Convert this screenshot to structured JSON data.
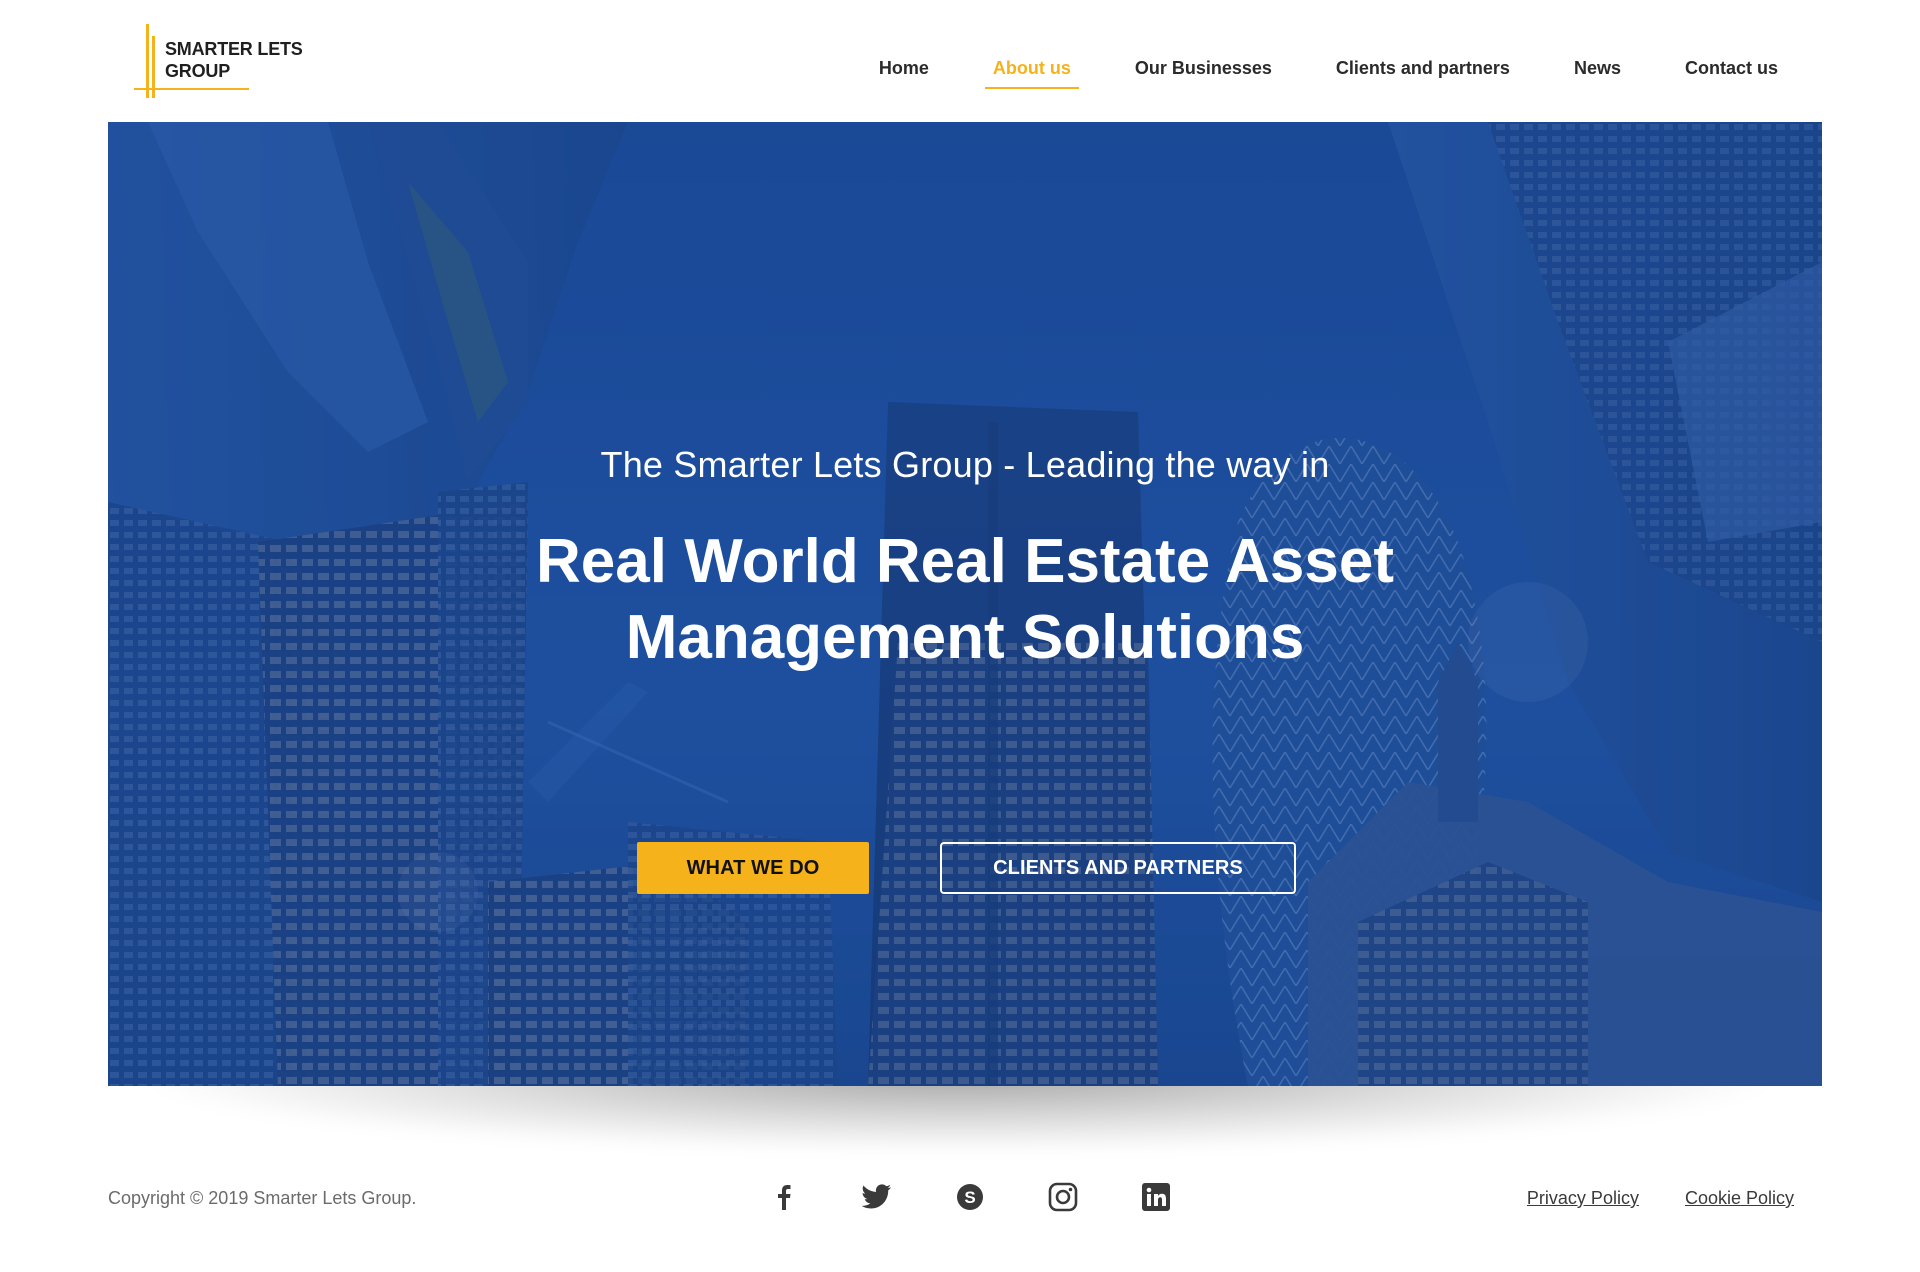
{
  "brand": {
    "name_line1": "SMARTER LETS",
    "name_line2": "GROUP",
    "accent_color": "#f5b21b"
  },
  "nav": {
    "items": [
      {
        "label": "Home",
        "active": false
      },
      {
        "label": "About us",
        "active": true
      },
      {
        "label": "Our Businesses",
        "active": false
      },
      {
        "label": "Clients and partners",
        "active": false
      },
      {
        "label": "News",
        "active": false
      },
      {
        "label": "Contact us",
        "active": false
      }
    ]
  },
  "hero": {
    "subtitle": "The Smarter Lets Group - Leading the way in",
    "title_line1": "Real World Real Estate Asset",
    "title_line2": "Management Solutions",
    "primary_button": "WHAT WE DO",
    "secondary_button": "CLIENTS AND PARTNERS",
    "overlay_color": "#1d50a0"
  },
  "footer": {
    "copyright": "Copyright © 2019 Smarter Lets Group.",
    "socials": [
      "facebook-icon",
      "twitter-icon",
      "skype-icon",
      "instagram-icon",
      "linkedin-icon"
    ],
    "links": [
      "Privacy Policy",
      "Cookie Policy"
    ]
  }
}
